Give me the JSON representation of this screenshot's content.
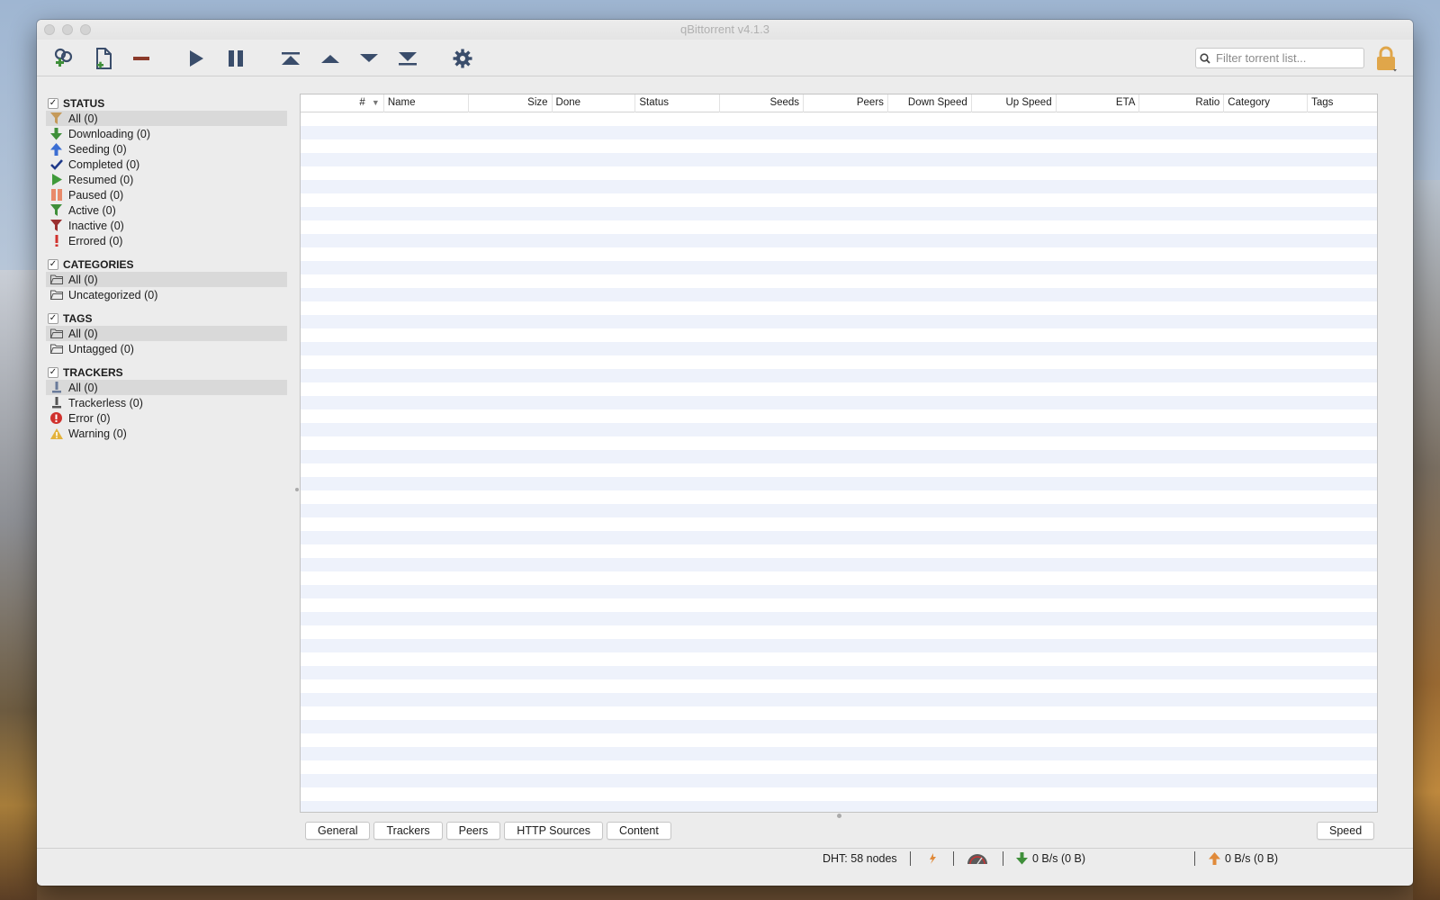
{
  "window": {
    "title": "qBittorrent v4.1.3"
  },
  "toolbar": {
    "buttons": [
      {
        "name": "add-torrent-link",
        "icon": "add-link-icon"
      },
      {
        "name": "add-torrent-file",
        "icon": "add-file-icon"
      },
      {
        "name": "delete",
        "icon": "minus-icon"
      },
      {
        "name": "resume",
        "icon": "play-icon"
      },
      {
        "name": "pause",
        "icon": "pause-icon"
      },
      {
        "name": "move-top",
        "icon": "move-top-icon"
      },
      {
        "name": "move-up",
        "icon": "move-up-icon"
      },
      {
        "name": "move-down",
        "icon": "move-down-icon"
      },
      {
        "name": "move-bottom",
        "icon": "move-bottom-icon"
      },
      {
        "name": "options",
        "icon": "gear-icon"
      }
    ],
    "filter_placeholder": "Filter torrent list...",
    "accent": "#3a4d6b"
  },
  "sidebar": {
    "status": {
      "header": "STATUS",
      "items": [
        {
          "label": "All (0)",
          "icon": "filter-icon",
          "color": "#c59a5a"
        },
        {
          "label": "Downloading (0)",
          "icon": "arrow-down-icon",
          "color": "#3f8f3a"
        },
        {
          "label": "Seeding (0)",
          "icon": "arrow-up-icon",
          "color": "#3b6ed3"
        },
        {
          "label": "Completed (0)",
          "icon": "checkmark-icon",
          "color": "#1f3a8a"
        },
        {
          "label": "Resumed (0)",
          "icon": "play-icon",
          "color": "#3f9a3a"
        },
        {
          "label": "Paused (0)",
          "icon": "pause-icon",
          "color": "#e98a6a"
        },
        {
          "label": "Active (0)",
          "icon": "filter-icon",
          "color": "#3f8f3a"
        },
        {
          "label": "Inactive (0)",
          "icon": "filter-icon",
          "color": "#9a2f2f"
        },
        {
          "label": "Errored (0)",
          "icon": "exclamation-icon",
          "color": "#d0312d"
        }
      ]
    },
    "categories": {
      "header": "CATEGORIES",
      "items": [
        {
          "label": "All (0)",
          "icon": "folder-icon"
        },
        {
          "label": "Uncategorized (0)",
          "icon": "folder-icon"
        }
      ]
    },
    "tags": {
      "header": "TAGS",
      "items": [
        {
          "label": "All (0)",
          "icon": "folder-icon"
        },
        {
          "label": "Untagged (0)",
          "icon": "folder-icon"
        }
      ]
    },
    "trackers": {
      "header": "TRACKERS",
      "items": [
        {
          "label": "All (0)",
          "icon": "tracker-icon"
        },
        {
          "label": "Trackerless (0)",
          "icon": "tracker-icon"
        },
        {
          "label": "Error (0)",
          "icon": "error-icon",
          "color": "#d0312d"
        },
        {
          "label": "Warning (0)",
          "icon": "warning-icon",
          "color": "#e3b23c"
        }
      ]
    }
  },
  "table": {
    "columns": [
      {
        "label": "#",
        "sorted": "desc"
      },
      {
        "label": "Name"
      },
      {
        "label": "Size"
      },
      {
        "label": "Done"
      },
      {
        "label": "Status"
      },
      {
        "label": "Seeds"
      },
      {
        "label": "Peers"
      },
      {
        "label": "Down Speed"
      },
      {
        "label": "Up Speed"
      },
      {
        "label": "ETA"
      },
      {
        "label": "Ratio"
      },
      {
        "label": "Category"
      },
      {
        "label": "Tags"
      }
    ],
    "rows": []
  },
  "bottom_tabs": [
    "General",
    "Trackers",
    "Peers",
    "HTTP Sources",
    "Content"
  ],
  "speed_button": "Speed",
  "statusbar": {
    "dht": "DHT: 58 nodes",
    "download": "0 B/s (0 B)",
    "upload": "0 B/s (0 B)"
  }
}
